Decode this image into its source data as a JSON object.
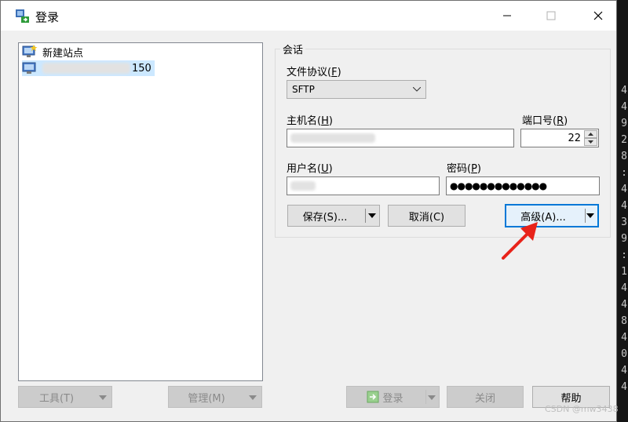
{
  "background": {
    "terminal_chars": [
      "4",
      "4",
      "9",
      "2",
      "8",
      ":",
      "4",
      "4",
      "3",
      "9",
      ":",
      "1",
      "4",
      "4",
      "8",
      "4",
      "0",
      "4",
      "4"
    ]
  },
  "window": {
    "title": "登录",
    "minimize_icon": "minimize-icon",
    "maximize_icon": "maximize-icon",
    "close_icon": "close-icon"
  },
  "sites": [
    {
      "label": "新建站点",
      "icon": "new-site-icon"
    },
    {
      "label": "150",
      "icon": "site-computer-icon",
      "selected": true
    }
  ],
  "session": {
    "group_label": "会话",
    "protocol_label": "文件协议(F)",
    "protocol_label_main": "文件协议(",
    "protocol_key": "F",
    "protocol_value": "SFTP",
    "host_label_main": "主机名(",
    "host_key": "H",
    "port_label_main": "端口号(",
    "port_key": "R",
    "port_value": "22",
    "user_label_main": "用户名(",
    "user_key": "U",
    "password_label_main": "密码(",
    "password_key": "P",
    "password_value": "●●●●●●●●●●●●●",
    "save_label": "保存(S)...",
    "cancel_label": "取消(C)",
    "advanced_label": "高级(A)..."
  },
  "footer": {
    "tools_label": "工具(T)",
    "manage_label": "管理(M)",
    "login_label": "登录",
    "close_label": "关闭",
    "help_label": "帮助"
  },
  "watermark": "CSDN @mw3438",
  "colors": {
    "accent": "#0078d7",
    "annotation_arrow": "#e8231a",
    "selected_bg": "#cce8ff"
  }
}
